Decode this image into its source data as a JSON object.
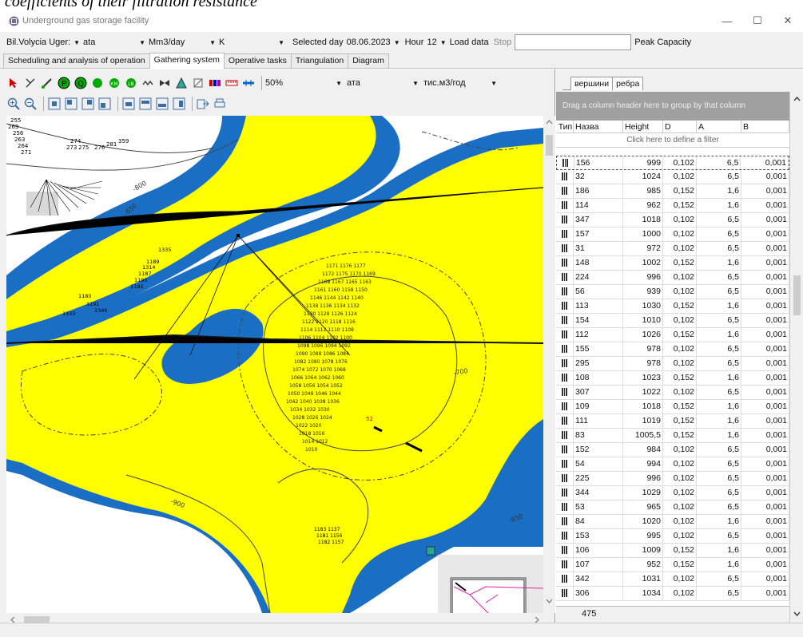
{
  "caption": "coefficients of their filtration resistance",
  "window": {
    "title": "Underground gas storage facility",
    "min_glyph": "—",
    "max_glyph": "☐",
    "close_glyph": "✕"
  },
  "options": {
    "storage": "Bil.Volycia Uger:",
    "pressure_unit": "ata",
    "flow_unit": "Mm3/day",
    "temp_unit": "K",
    "selected_day_label": "Selected day",
    "selected_day": "08.06.2023",
    "hour_label": "Hour",
    "hour": "12",
    "load_data": "Load data",
    "stop": "Stop",
    "peak_capacity": "Peak Capacity"
  },
  "tabs": [
    "Scheduling and analysis of operation",
    "Gathering system",
    "Operative tasks",
    "Triangulation",
    "Diagram"
  ],
  "map_toolbar": {
    "zoom": "50%",
    "pressure_unit": "ата",
    "flow_unit": "тис.м3/год"
  },
  "map_labels": {
    "contours": [
      "-900",
      "-850",
      "-800",
      "-750",
      "-700",
      "-650"
    ],
    "wells": [
      "1335",
      "1189",
      "1314",
      "1187",
      "1190",
      "1192",
      "1180",
      "1191",
      "1346",
      "1333"
    ]
  },
  "right_tabs": [
    "вершини",
    "ребра"
  ],
  "group_hint": "Drag a column header here to group by that column",
  "filter_hint": "Click here to define a filter",
  "columns": [
    "Тип",
    "Назва",
    "Height",
    "D",
    "A",
    "B"
  ],
  "rows": [
    [
      "156",
      "999",
      "0,102",
      "6,5",
      "0,001"
    ],
    [
      "32",
      "1024",
      "0,102",
      "6,5",
      "0,001"
    ],
    [
      "186",
      "985",
      "0,152",
      "1,6",
      "0,001"
    ],
    [
      "114",
      "962",
      "0,152",
      "1,6",
      "0,001"
    ],
    [
      "347",
      "1018",
      "0,102",
      "6,5",
      "0,001"
    ],
    [
      "157",
      "1000",
      "0,102",
      "6,5",
      "0,001"
    ],
    [
      "31",
      "972",
      "0,102",
      "6,5",
      "0,001"
    ],
    [
      "148",
      "1002",
      "0,152",
      "1,6",
      "0,001"
    ],
    [
      "224",
      "996",
      "0,102",
      "6,5",
      "0,001"
    ],
    [
      "56",
      "939",
      "0,102",
      "6,5",
      "0,001"
    ],
    [
      "113",
      "1030",
      "0,152",
      "1,6",
      "0,001"
    ],
    [
      "154",
      "1010",
      "0,102",
      "6,5",
      "0,001"
    ],
    [
      "112",
      "1026",
      "0,152",
      "1,6",
      "0,001"
    ],
    [
      "155",
      "978",
      "0,102",
      "6,5",
      "0,001"
    ],
    [
      "295",
      "978",
      "0,102",
      "6,5",
      "0,001"
    ],
    [
      "108",
      "1023",
      "0,152",
      "1,6",
      "0,001"
    ],
    [
      "307",
      "1022",
      "0,102",
      "6,5",
      "0,001"
    ],
    [
      "109",
      "1018",
      "0,152",
      "1,6",
      "0,001"
    ],
    [
      "111",
      "1019",
      "0,152",
      "1,6",
      "0,001"
    ],
    [
      "83",
      "1005,5",
      "0,152",
      "1,6",
      "0,001"
    ],
    [
      "152",
      "984",
      "0,102",
      "6,5",
      "0,001"
    ],
    [
      "54",
      "994",
      "0,102",
      "6,5",
      "0,001"
    ],
    [
      "225",
      "996",
      "0,102",
      "6,5",
      "0,001"
    ],
    [
      "344",
      "1029",
      "0,102",
      "6,5",
      "0,001"
    ],
    [
      "53",
      "965",
      "0,102",
      "6,5",
      "0,001"
    ],
    [
      "84",
      "1020",
      "0,102",
      "1,6",
      "0,001"
    ],
    [
      "153",
      "995",
      "0,102",
      "6,5",
      "0,001"
    ],
    [
      "106",
      "1009",
      "0,152",
      "1,6",
      "0,001"
    ],
    [
      "107",
      "952",
      "0,152",
      "1,6",
      "0,001"
    ],
    [
      "342",
      "1031",
      "0,102",
      "6,5",
      "0,001"
    ],
    [
      "306",
      "1034",
      "0,102",
      "6,5",
      "0,001"
    ]
  ],
  "footer_count": "475",
  "colors": {
    "water": "#1a6fc4",
    "field": "#ffff00",
    "group_bar": "#a0a0a0"
  }
}
